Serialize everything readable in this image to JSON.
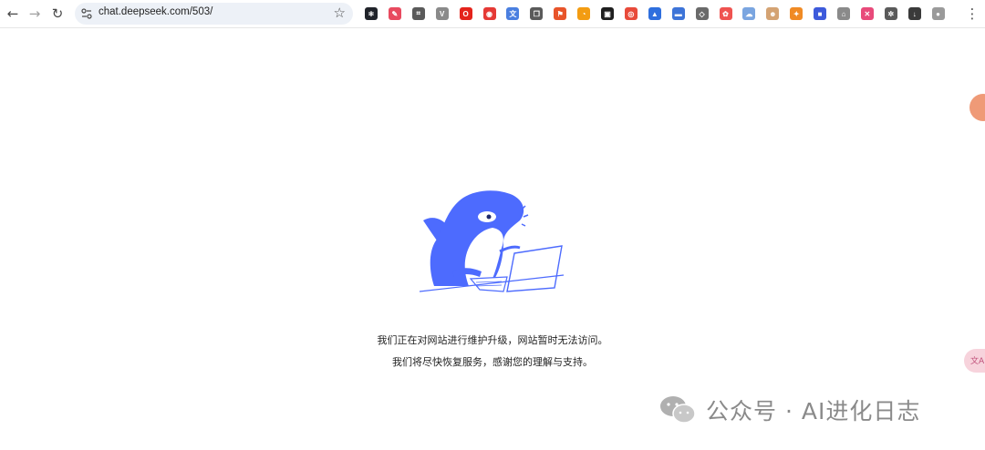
{
  "browser": {
    "url": "chat.deepseek.com/503/",
    "nav": {
      "back": "←",
      "forward": "→",
      "reload": "↻"
    },
    "menu_icon": "⋮",
    "extensions": [
      {
        "name": "react-devtools",
        "color": "#20232a",
        "glyph": "⚛"
      },
      {
        "name": "pen-tool",
        "color": "#e84a5f",
        "glyph": "✎"
      },
      {
        "name": "crop-tool",
        "color": "#5a5a5a",
        "glyph": "⌗"
      },
      {
        "name": "vue-devtools",
        "color": "#8a8a8a",
        "glyph": "V"
      },
      {
        "name": "opera",
        "color": "#e4231b",
        "glyph": "O"
      },
      {
        "name": "screenshot",
        "color": "#e53935",
        "glyph": "◉"
      },
      {
        "name": "translate",
        "color": "#4a7fe0",
        "glyph": "文"
      },
      {
        "name": "copy",
        "color": "#5a5a5a",
        "glyph": "❐"
      },
      {
        "name": "flag",
        "color": "#e8542a",
        "glyph": "⚑"
      },
      {
        "name": "rss",
        "color": "#f39c12",
        "glyph": "◔"
      },
      {
        "name": "tv",
        "color": "#1f1f1f",
        "glyph": "▣"
      },
      {
        "name": "target",
        "color": "#e84a3a",
        "glyph": "◎"
      },
      {
        "name": "triangle",
        "color": "#2f6fde",
        "glyph": "▲"
      },
      {
        "name": "monitor",
        "color": "#3d74d8",
        "glyph": "▬"
      },
      {
        "name": "cube",
        "color": "#6a6a6a",
        "glyph": "◇"
      },
      {
        "name": "colorful",
        "color": "#ef5350",
        "glyph": "✿"
      },
      {
        "name": "cloud",
        "color": "#7aa5e0",
        "glyph": "☁"
      },
      {
        "name": "mascot",
        "color": "#d4a373",
        "glyph": "☻"
      },
      {
        "name": "fox",
        "color": "#f08a24",
        "glyph": "✦"
      },
      {
        "name": "puzzle-blue",
        "color": "#3d5adb",
        "glyph": "■"
      },
      {
        "name": "home-badge",
        "color": "#8a8a8a",
        "glyph": "⌂"
      },
      {
        "name": "pink-square",
        "color": "#e84a7a",
        "glyph": "✕"
      },
      {
        "name": "extensions",
        "color": "#5a5a5a",
        "glyph": "✲"
      },
      {
        "name": "download",
        "color": "#3a3a3a",
        "glyph": "↓"
      },
      {
        "name": "profile",
        "color": "#9a9a9a",
        "glyph": "●"
      }
    ]
  },
  "page": {
    "message_line1": "我们正在对网站进行维护升级，网站暂时无法访问。",
    "message_line2": "我们将尽快恢复服务，感谢您的理解与支持。"
  },
  "watermark": {
    "text": "公众号 · AI进化日志"
  },
  "colors": {
    "whale": "#4d6bfe",
    "accent": "#4d6bfe"
  }
}
